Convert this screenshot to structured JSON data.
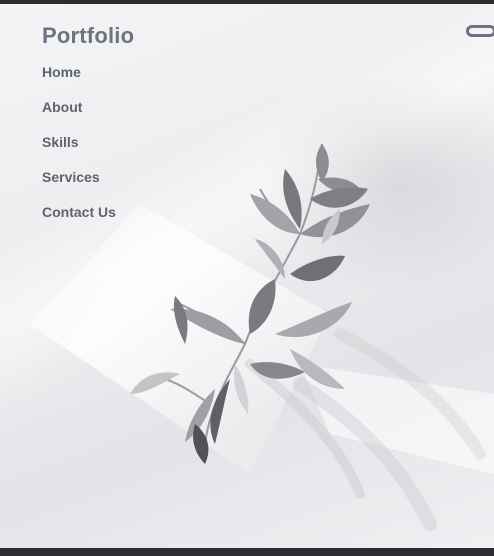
{
  "header": {
    "logo": "Portfolio"
  },
  "nav": {
    "items": [
      {
        "label": "Home"
      },
      {
        "label": "About"
      },
      {
        "label": "Skills"
      },
      {
        "label": "Services"
      },
      {
        "label": "Contact Us"
      }
    ]
  },
  "toggle": {
    "icon": "toggle-switch-icon"
  },
  "hero": {
    "image": "eucalyptus-branch-photo"
  },
  "colors": {
    "logo": "#6b7480",
    "nav_text": "#5c6470",
    "background": "#ececef",
    "leaf": "#8a8a8e"
  }
}
